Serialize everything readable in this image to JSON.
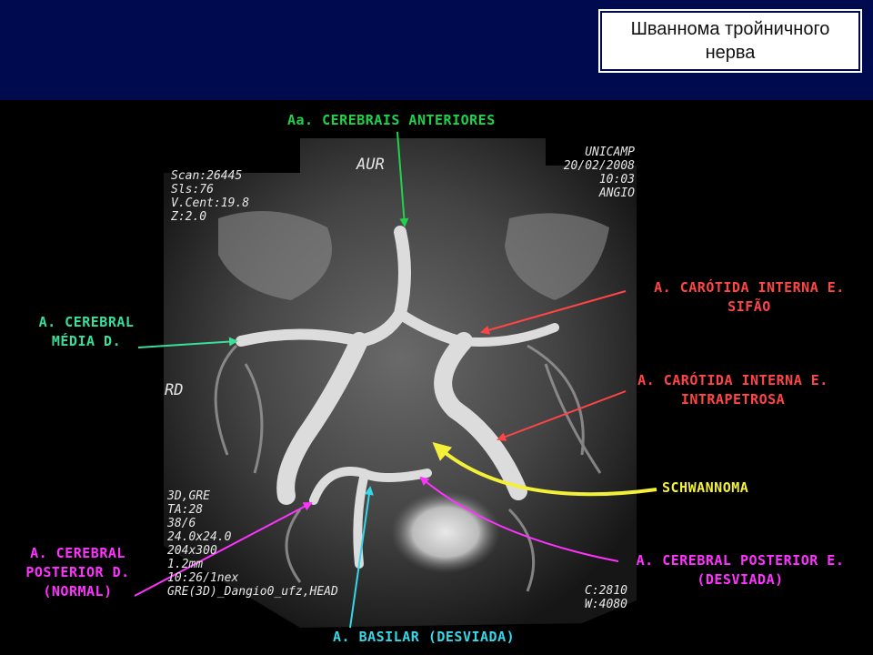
{
  "title": "Шваннома тройничного нерва",
  "labels": {
    "ant": "Aa. CEREBRAIS ANTERIORES",
    "car_sifao_1": "A. CARÓTIDA INTERNA E.",
    "car_sifao_2": "SIFÃO",
    "car_intra_1": "A. CARÓTIDA INTERNA E.",
    "car_intra_2": "INTRAPETROSA",
    "media_1": "A. CEREBRAL",
    "media_2": "MÉDIA D.",
    "schwannoma": "SCHWANNOMA",
    "post_d_1": "A. CEREBRAL",
    "post_d_2": "POSTERIOR D.",
    "post_d_3": "(NORMAL)",
    "post_e_1": "A. CEREBRAL POSTERIOR E.",
    "post_e_2": "(DESVIADA)",
    "basilar": "A. BASILAR (DESVIADA)"
  },
  "scan_info": {
    "aur": "AUR",
    "rd": "RD",
    "top_left": [
      "Scan:26445",
      "Sls:76",
      "V.Cent:19.8",
      "Z:2.0"
    ],
    "top_right": [
      "UNICAMP",
      "20/02/2008",
      "10:03",
      "ANGIO"
    ],
    "bottom_left": [
      "3D,GRE",
      "TA:28",
      "38/6",
      "24.0x24.0",
      "204x300",
      "1.2mm",
      "10:26/1nex",
      "GRE(3D)_Dangio0_ufz,HEAD"
    ],
    "bottom_right": [
      "C:2810",
      "W:4080"
    ]
  },
  "colors": {
    "top_bar": "#000a4e",
    "green_label": "#1fd24a",
    "red_label": "#ff4545",
    "yellow_label": "#f4f03a",
    "magenta_label": "#ff33ff",
    "cyan_label": "#37d7e8"
  }
}
